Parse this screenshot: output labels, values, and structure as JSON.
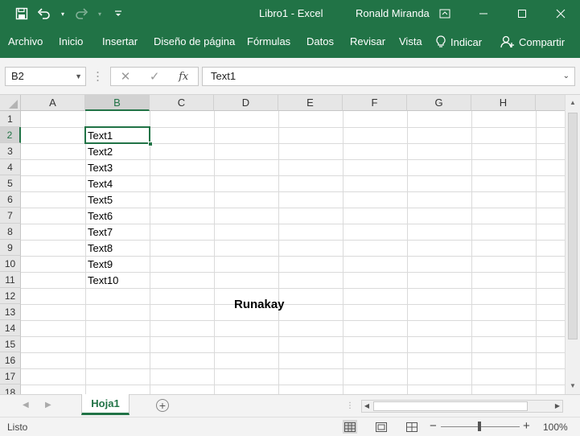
{
  "titlebar": {
    "title": "Libro1  -  Excel",
    "user": "Ronald Miranda",
    "icons": [
      "save-icon",
      "undo-icon",
      "redo-icon",
      "customize-qat-icon",
      "ribbon-display-icon",
      "minimize-icon",
      "maximize-icon",
      "close-icon"
    ]
  },
  "ribbon": {
    "tabs": [
      "Archivo",
      "Inicio",
      "Insertar",
      "Diseño de página",
      "Fórmulas",
      "Datos",
      "Revisar",
      "Vista"
    ],
    "tell_me": "Indicar",
    "share": "Compartir"
  },
  "formula_bar": {
    "name_box": "B2",
    "formula": "Text1",
    "fx": "fx"
  },
  "grid": {
    "columns": [
      "A",
      "B",
      "C",
      "D",
      "E",
      "F",
      "G",
      "H"
    ],
    "rows": [
      "1",
      "2",
      "3",
      "4",
      "5",
      "6",
      "7",
      "8",
      "9",
      "10",
      "11",
      "12",
      "13",
      "14",
      "15",
      "16",
      "17",
      "18"
    ],
    "selected_cell": "B2",
    "column_b_values": [
      "Text1",
      "Text2",
      "Text3",
      "Text4",
      "Text5",
      "Text6",
      "Text7",
      "Text8",
      "Text9",
      "Text10"
    ],
    "overlay_text": "Runakay"
  },
  "sheets": {
    "tabs": [
      "Hoja1"
    ],
    "active": "Hoja1"
  },
  "status": {
    "text": "Listo",
    "zoom": "100%",
    "zoom_minus": "−",
    "zoom_plus": "+"
  },
  "colors": {
    "accent": "#217346",
    "header_bg": "#e6e6e6",
    "gridline": "#dadada"
  }
}
